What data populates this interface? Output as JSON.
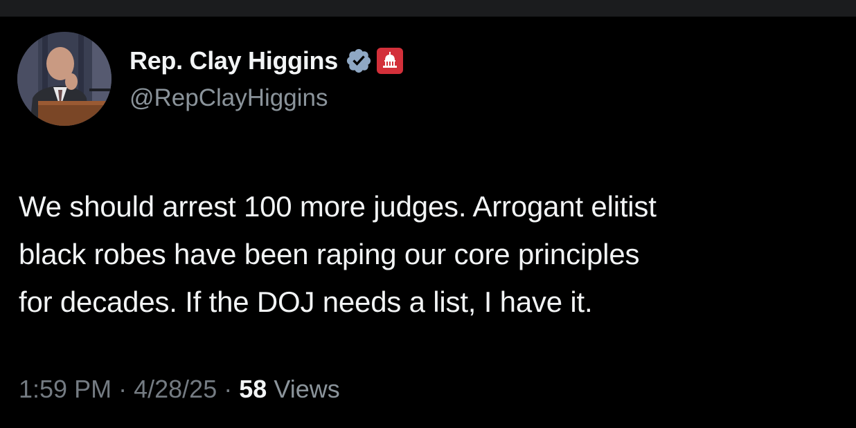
{
  "author": {
    "name": "Rep. Clay Higgins",
    "handle": "@RepClayHiggins",
    "verified_icon": "verified-badge-icon",
    "affiliation_icon": "capitol-dome-icon"
  },
  "tweet": {
    "lines": [
      "We should arrest 100 more judges. Arrogant elitist",
      "black robes have been raping our core principles",
      "for decades. If the DOJ needs a list, I have it."
    ]
  },
  "meta": {
    "time": "1:59 PM",
    "separator": "·",
    "date": "4/28/25",
    "views_count": "58",
    "views_label": "Views"
  },
  "colors": {
    "background": "#000000",
    "primary_text": "#f2f4f5",
    "secondary_text": "#8b949b",
    "verified": "#8fa8c4",
    "affiliation_badge": "#d3303a"
  }
}
